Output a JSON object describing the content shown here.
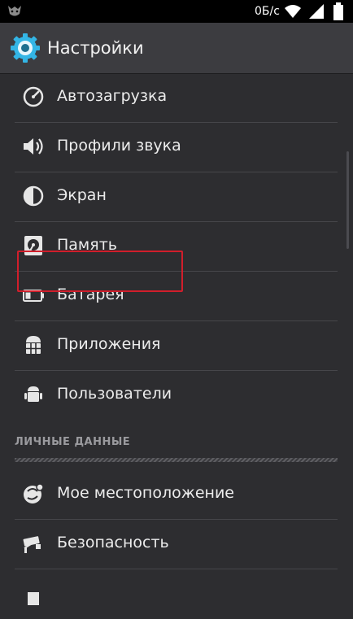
{
  "status_bar": {
    "speed": "0Б/с",
    "icons": [
      "notification-icon",
      "wifi-icon",
      "signal-icon",
      "battery-icon"
    ]
  },
  "action_bar": {
    "title": "Настройки",
    "icon": "settings-gear-icon"
  },
  "items": [
    {
      "label": "Автозагрузка",
      "icon": "autostart-icon"
    },
    {
      "label": "Профили звука",
      "icon": "sound-icon"
    },
    {
      "label": "Экран",
      "icon": "display-icon"
    },
    {
      "label": "Память",
      "icon": "storage-icon"
    },
    {
      "label": "Батарея",
      "icon": "battery-icon"
    },
    {
      "label": "Приложения",
      "icon": "apps-icon",
      "highlighted": true
    },
    {
      "label": "Пользователи",
      "icon": "users-icon"
    }
  ],
  "section": {
    "title": "ЛИЧНЫЕ ДАННЫЕ"
  },
  "section_items": [
    {
      "label": "Мое местоположение",
      "icon": "location-icon"
    },
    {
      "label": "Безопасность",
      "icon": "security-icon"
    }
  ],
  "colors": {
    "background": "#2d2d30",
    "highlight": "#d11e2b",
    "accent": "#33b5e5"
  }
}
